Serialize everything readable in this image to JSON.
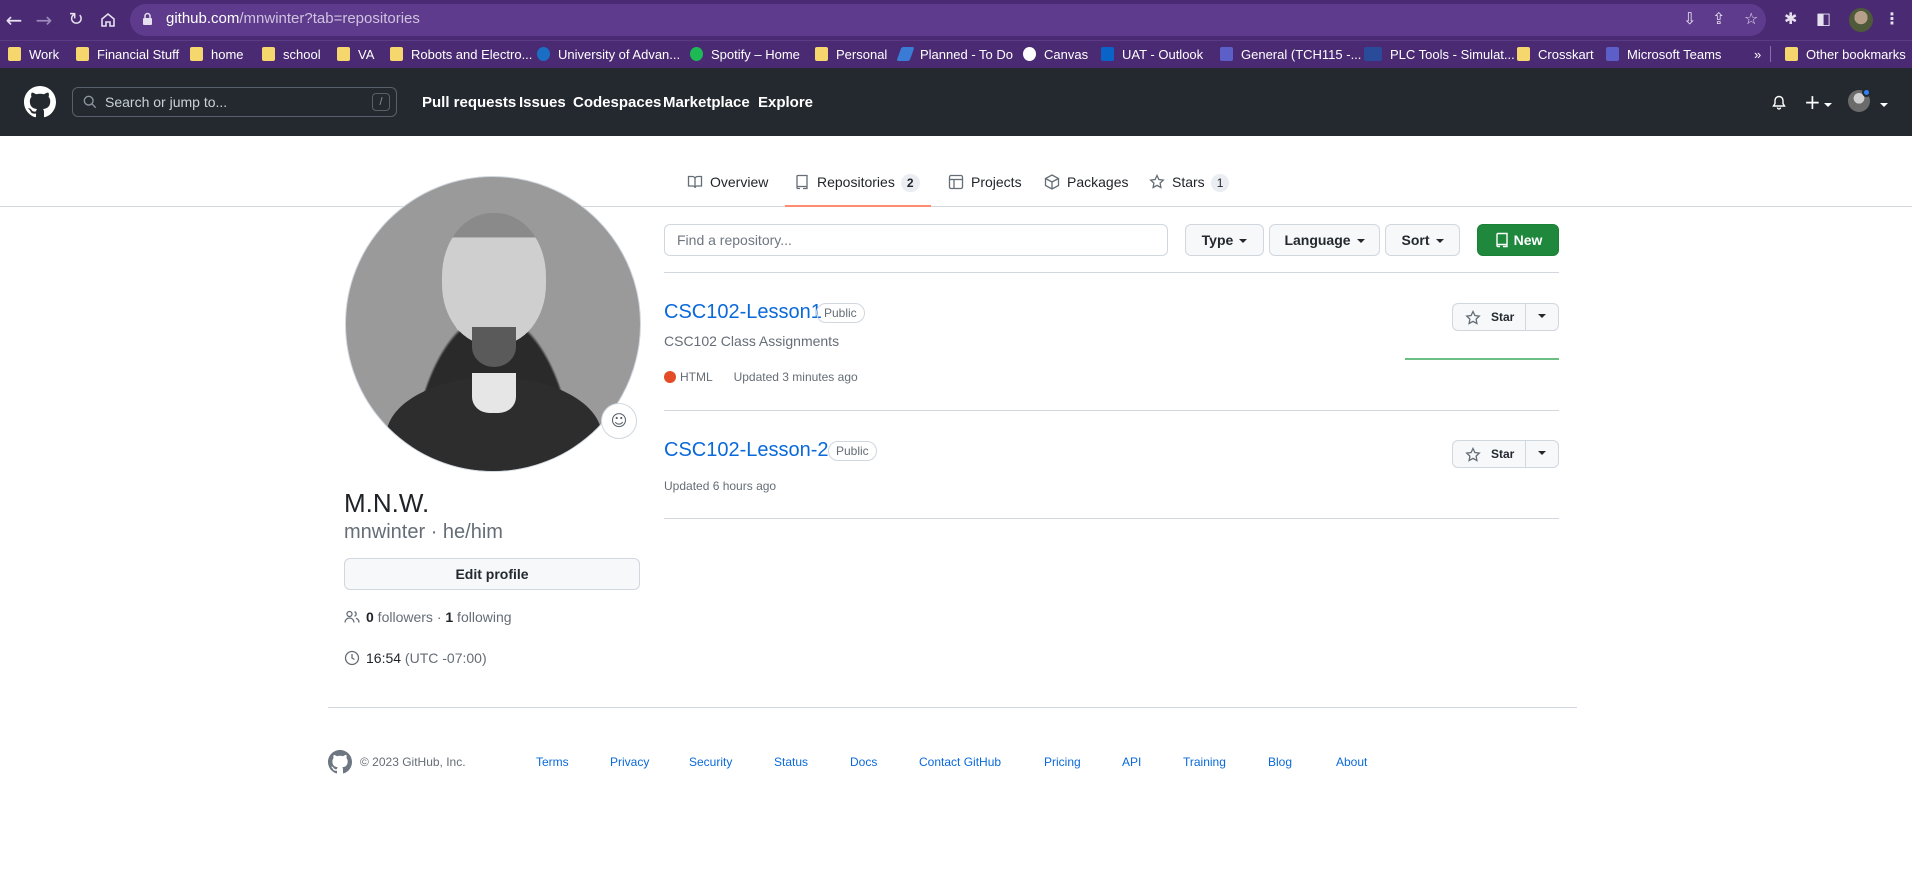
{
  "browser": {
    "url_host": "github.com",
    "url_path": "/mnwinter?tab=repositories",
    "bookmarks": [
      {
        "label": "Work"
      },
      {
        "label": "Financial Stuff"
      },
      {
        "label": "home"
      },
      {
        "label": "school"
      },
      {
        "label": "VA"
      },
      {
        "label": "Robots and Electro..."
      },
      {
        "label": "University of Advan..."
      },
      {
        "label": "Spotify – Home"
      },
      {
        "label": "Personal"
      },
      {
        "label": "Planned - To Do"
      },
      {
        "label": "Canvas"
      },
      {
        "label": "UAT - Outlook"
      },
      {
        "label": "General (TCH115 -..."
      },
      {
        "label": "PLC Tools - Simulat..."
      },
      {
        "label": "Crosskart"
      },
      {
        "label": "Microsoft Teams"
      }
    ],
    "more_bookmarks": "»",
    "other_bookmarks": "Other bookmarks"
  },
  "header": {
    "search_placeholder": "Search or jump to...",
    "search_shortcut": "/",
    "nav": [
      "Pull requests",
      "Issues",
      "Codespaces",
      "Marketplace",
      "Explore"
    ]
  },
  "tabs": [
    {
      "label": "Overview",
      "count": null
    },
    {
      "label": "Repositories",
      "count": "2"
    },
    {
      "label": "Projects",
      "count": null
    },
    {
      "label": "Packages",
      "count": null
    },
    {
      "label": "Stars",
      "count": "1"
    }
  ],
  "profile": {
    "name": "M.N.W.",
    "username": "mnwinter · he/him",
    "edit_label": "Edit profile",
    "followers_count": "0",
    "followers_label": " followers · ",
    "following_count": "1",
    "following_label": " following",
    "time": "16:54",
    "timezone": " (UTC -07:00)"
  },
  "controls": {
    "find_placeholder": "Find a repository...",
    "type_label": "Type",
    "language_label": "Language",
    "sort_label": "Sort",
    "new_label": "New"
  },
  "repos": [
    {
      "name": "CSC102-Lesson1",
      "visibility": "Public",
      "description": "CSC102 Class Assignments",
      "language": "HTML",
      "language_color": "#e34c26",
      "updated": "Updated 3 minutes ago",
      "star_label": "Star"
    },
    {
      "name": "CSC102-Lesson-2",
      "visibility": "Public",
      "description": "",
      "language": "",
      "updated": "Updated 6 hours ago",
      "star_label": "Star"
    }
  ],
  "footer": {
    "copyright": "© 2023 GitHub, Inc.",
    "links": [
      "Terms",
      "Privacy",
      "Security",
      "Status",
      "Docs",
      "Contact GitHub",
      "Pricing",
      "API",
      "Training",
      "Blog",
      "About"
    ]
  },
  "colors": {
    "browser_frame": "#4a2a72",
    "github_header": "#24292f",
    "link": "#0969da",
    "new_button": "#1f883d",
    "tab_underline": "#fd8c73"
  }
}
